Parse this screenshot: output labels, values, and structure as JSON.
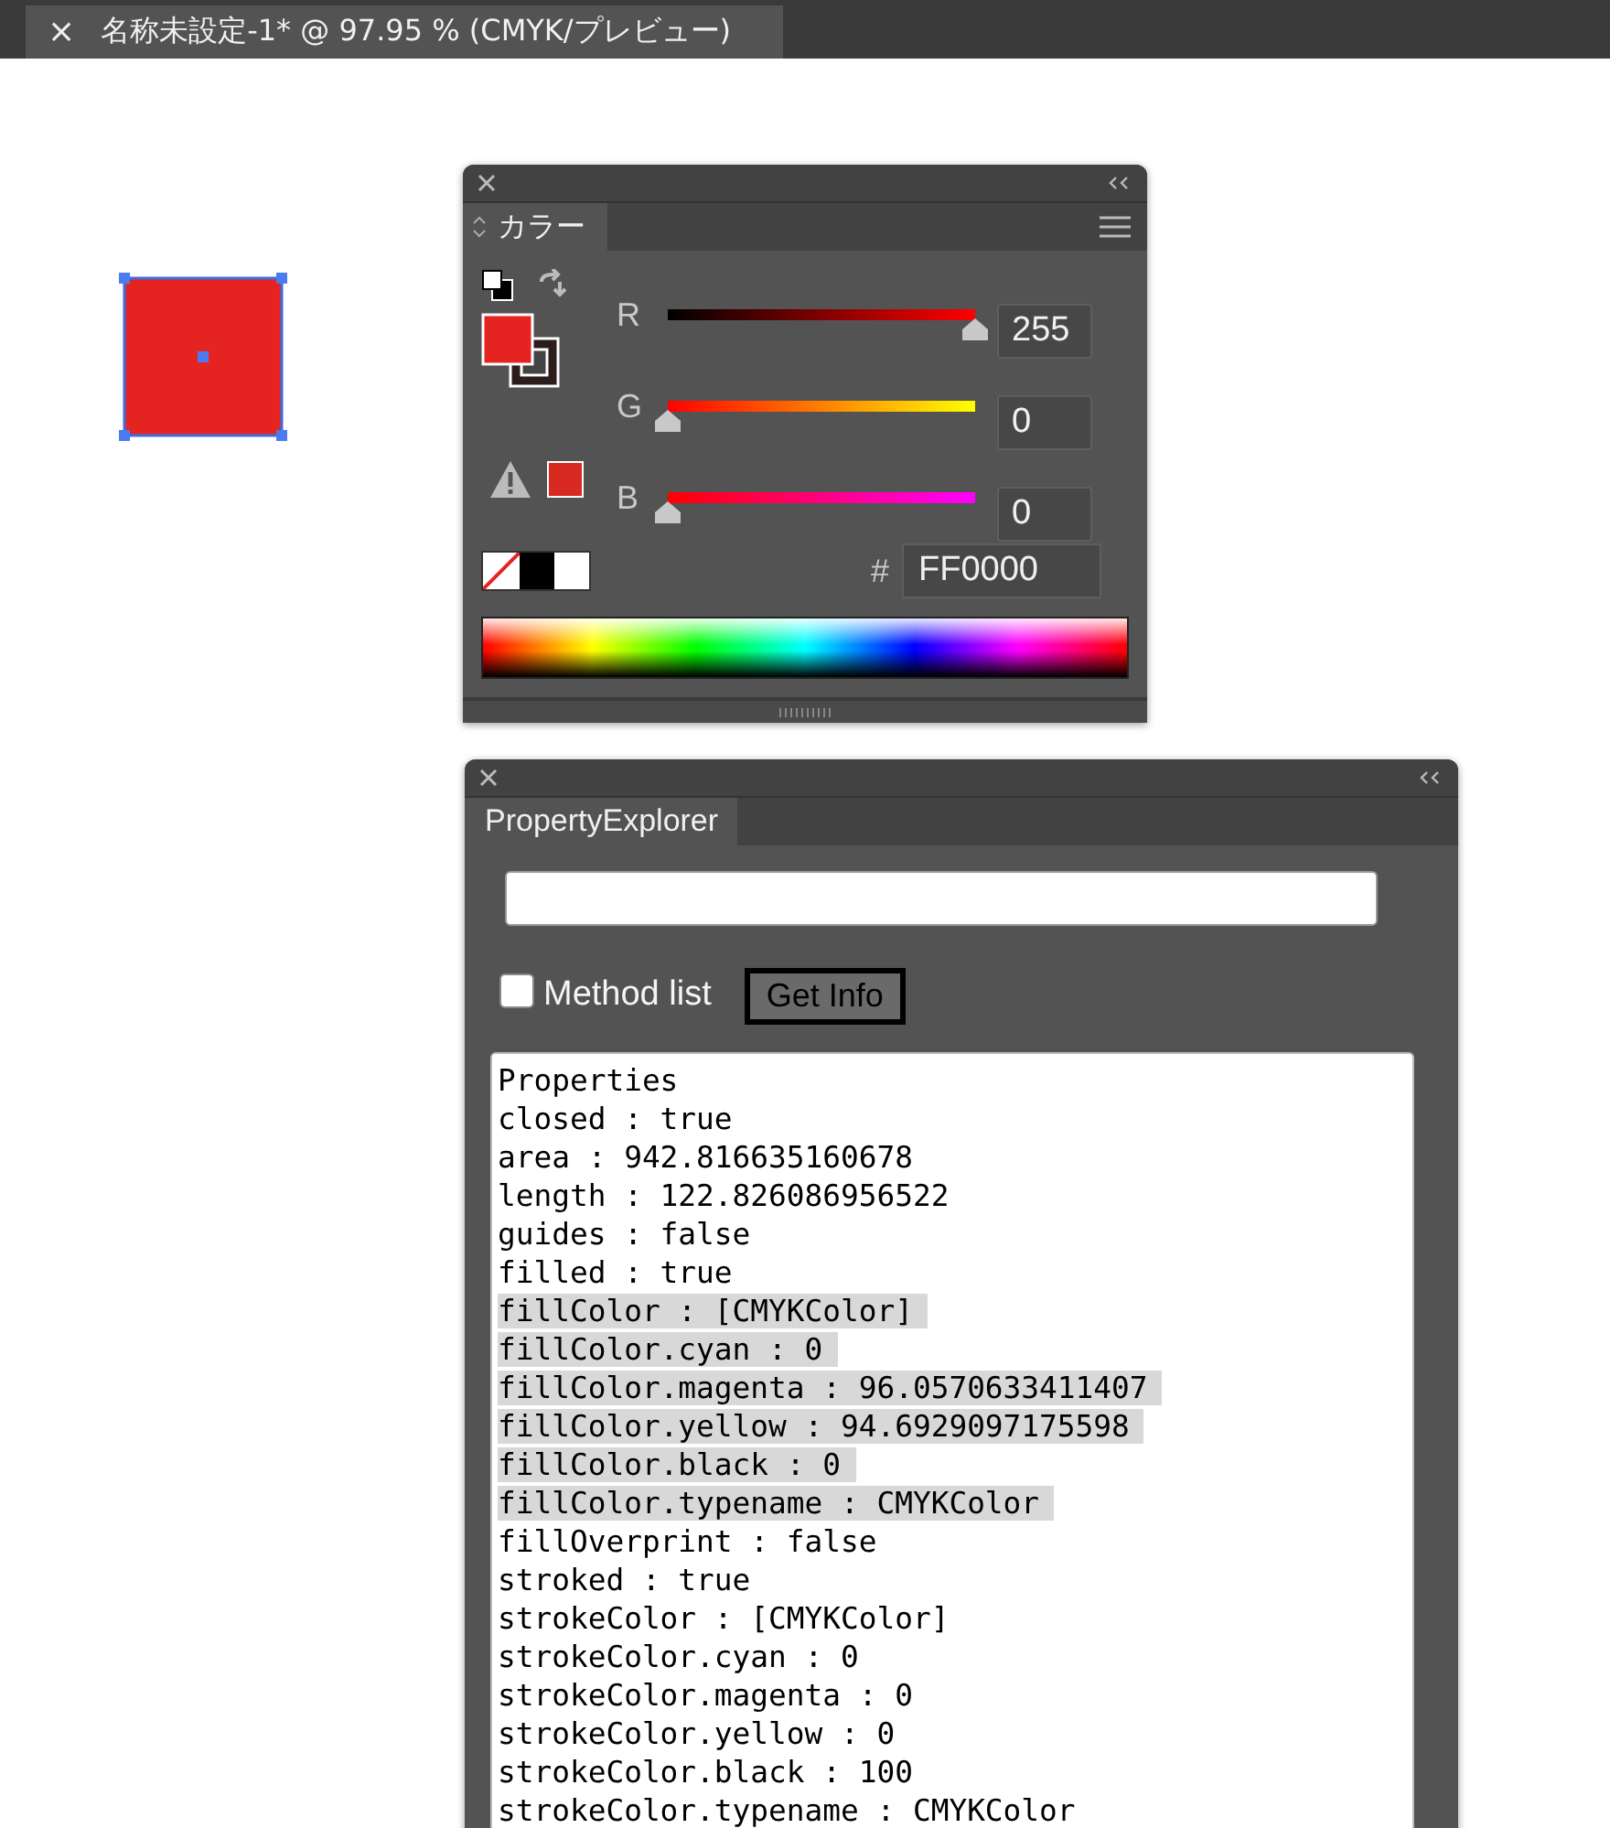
{
  "document_tab": {
    "close": "×",
    "title": "名称未設定-1* @ 97.95 % (CMYK/プレビュー)"
  },
  "color_panel": {
    "tab": "カラー",
    "channels": [
      {
        "label": "R",
        "level": 1,
        "value": "255"
      },
      {
        "label": "G",
        "level": 0,
        "value": "0"
      },
      {
        "label": "B",
        "level": 0,
        "value": "0"
      }
    ],
    "hex_label": "#",
    "hex": "FF0000"
  },
  "explorer_panel": {
    "tab": "PropertyExplorer",
    "method_list": {
      "label": "Method list",
      "checked": false
    },
    "button": "Get Info",
    "lines": [
      {
        "text": "Properties",
        "highlighted": false
      },
      {
        "text": "closed : true",
        "highlighted": false
      },
      {
        "text": "area : 942.816635160678",
        "highlighted": false
      },
      {
        "text": "length : 122.826086956522",
        "highlighted": false
      },
      {
        "text": "guides : false",
        "highlighted": false
      },
      {
        "text": "filled : true",
        "highlighted": false
      },
      {
        "text": "fillColor : [CMYKColor]",
        "highlighted": true
      },
      {
        "text": "fillColor.cyan : 0",
        "highlighted": true
      },
      {
        "text": "fillColor.magenta : 96.0570633411407",
        "highlighted": true
      },
      {
        "text": "fillColor.yellow : 94.6929097175598",
        "highlighted": true
      },
      {
        "text": "fillColor.black : 0",
        "highlighted": true
      },
      {
        "text": "fillColor.typename : CMYKColor",
        "highlighted": true
      },
      {
        "text": "fillOverprint : false",
        "highlighted": false
      },
      {
        "text": "stroked : true",
        "highlighted": false
      },
      {
        "text": "strokeColor : [CMYKColor]",
        "highlighted": false
      },
      {
        "text": "strokeColor.cyan : 0",
        "highlighted": false
      },
      {
        "text": "strokeColor.magenta : 0",
        "highlighted": false
      },
      {
        "text": "strokeColor.yellow : 0",
        "highlighted": false
      },
      {
        "text": "strokeColor.black : 100",
        "highlighted": false
      },
      {
        "text": "strokeColor.typename : CMYKColor",
        "highlighted": false
      }
    ]
  }
}
